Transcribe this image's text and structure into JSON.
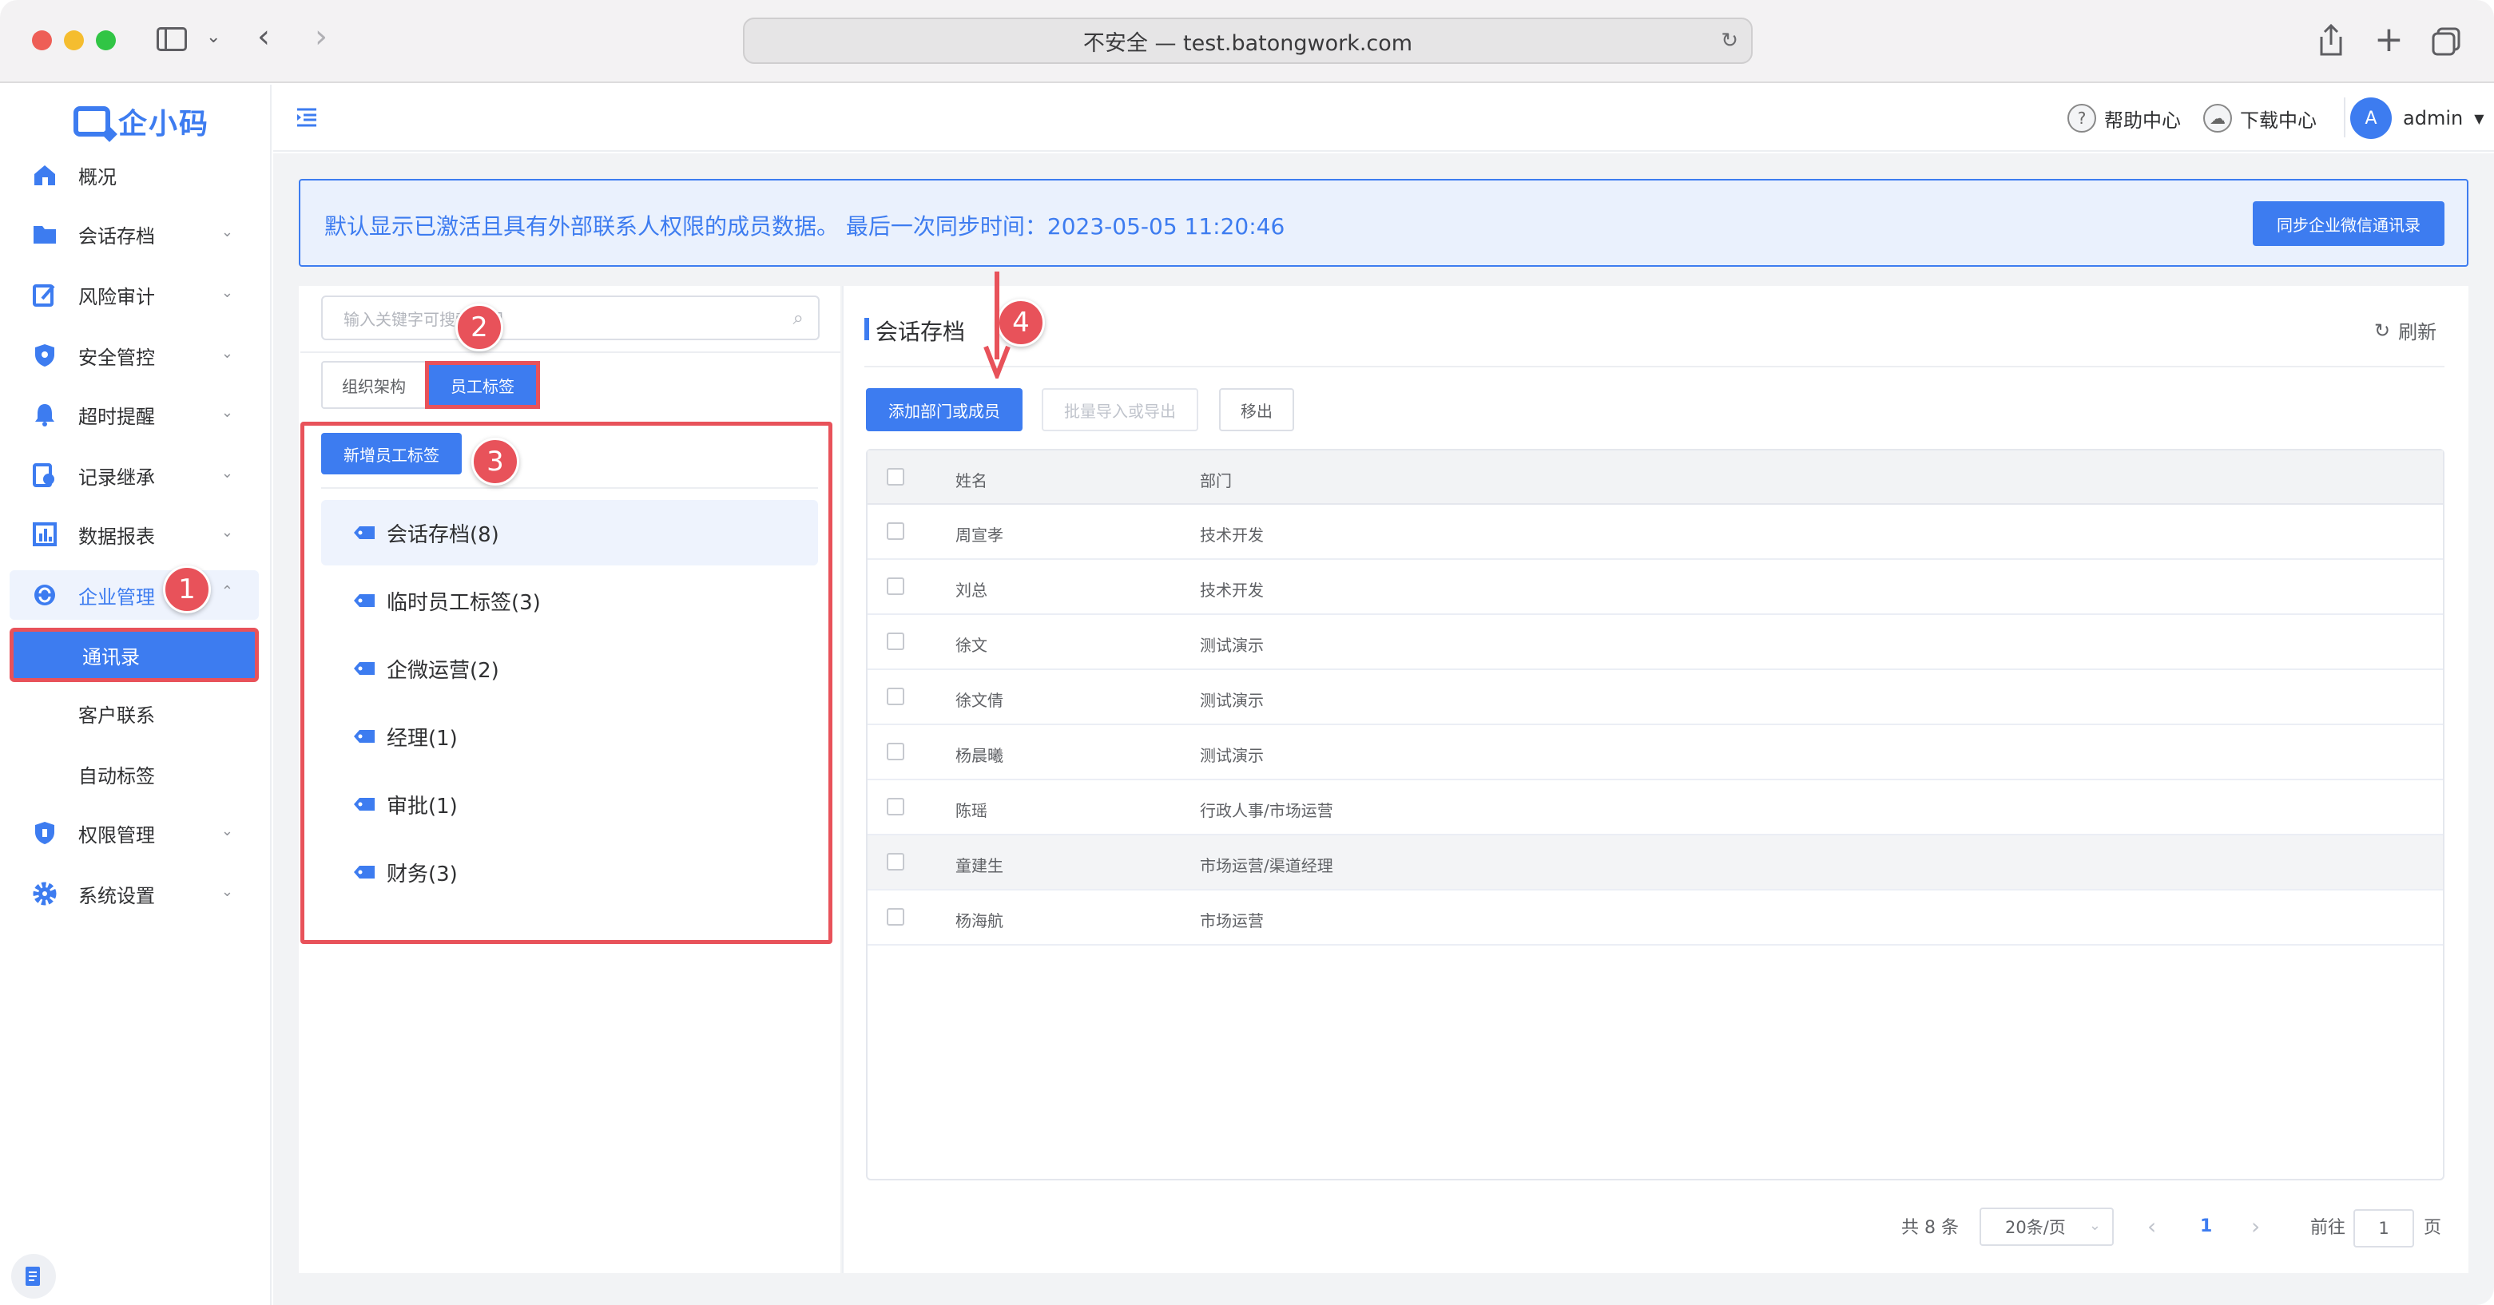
{
  "browser": {
    "url": "不安全 — test.batongwork.com"
  },
  "app": {
    "logo": "企小码"
  },
  "sidebar": {
    "items": [
      {
        "label": "概况",
        "icon": "home-icon"
      },
      {
        "label": "会话存档",
        "icon": "folder-icon"
      },
      {
        "label": "风险审计",
        "icon": "edit-icon"
      },
      {
        "label": "安全管控",
        "icon": "shield-icon"
      },
      {
        "label": "超时提醒",
        "icon": "bell-icon"
      },
      {
        "label": "记录继承",
        "icon": "inherit-icon"
      },
      {
        "label": "数据报表",
        "icon": "chart-icon"
      },
      {
        "label": "企业管理",
        "icon": "enterprise-icon"
      },
      {
        "label": "权限管理",
        "icon": "permission-icon"
      },
      {
        "label": "系统设置",
        "icon": "settings-icon"
      }
    ],
    "sub_items": [
      "通讯录",
      "客户联系",
      "自动标签"
    ]
  },
  "header": {
    "help": "帮助中心",
    "download": "下载中心",
    "avatar": "A",
    "user": "admin"
  },
  "notice": {
    "text": "默认显示已激活且具有外部联系人权限的成员数据。 最后一次同步时间：2023-05-05 11:20:46",
    "sync_button": "同步企业微信通讯录"
  },
  "left": {
    "search_placeholder": "输入关键字可搜索部门",
    "tab_org": "组织架构",
    "tab_tags": "员工标签",
    "add_tag_button": "新增员工标签",
    "tags": [
      "会话存档(8)",
      "临时员工标签(3)",
      "企微运营(2)",
      "经理(1)",
      "审批(1)",
      "财务(3)"
    ]
  },
  "right": {
    "title": "会话存档",
    "refresh": "刷新",
    "add_button": "添加部门或成员",
    "import_button": "批量导入或导出",
    "remove_button": "移出",
    "columns": [
      "姓名",
      "部门"
    ],
    "rows": [
      {
        "name": "周宣孝",
        "dept": "技术开发"
      },
      {
        "name": "刘总",
        "dept": "技术开发"
      },
      {
        "name": "徐文",
        "dept": "测试演示"
      },
      {
        "name": "徐文倩",
        "dept": "测试演示"
      },
      {
        "name": "杨晨曦",
        "dept": "测试演示"
      },
      {
        "name": "陈瑶",
        "dept": "行政人事/市场运营"
      },
      {
        "name": "童建生",
        "dept": "市场运营/渠道经理"
      },
      {
        "name": "杨海航",
        "dept": "市场运营"
      }
    ]
  },
  "pagination": {
    "total": "共 8 条",
    "page_size": "20条/页",
    "current_page": "1",
    "goto_prefix": "前往",
    "goto_value": "1",
    "goto_suffix": "页"
  },
  "annotations": [
    "1",
    "2",
    "3",
    "4"
  ]
}
